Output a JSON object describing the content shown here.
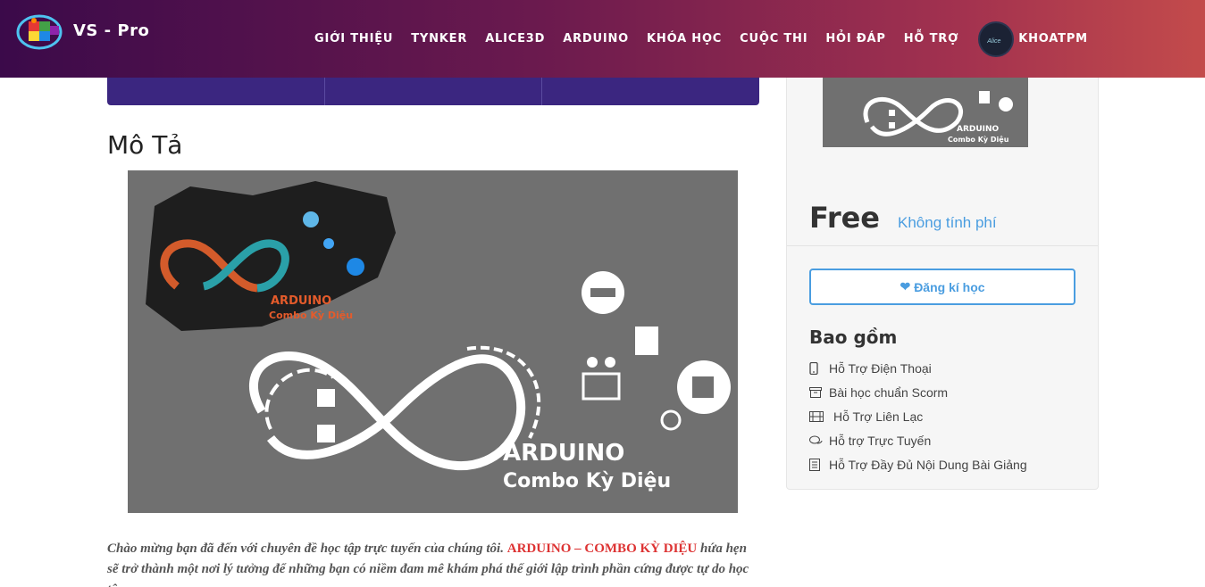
{
  "brand": {
    "name": "VS - Pro"
  },
  "nav": {
    "items": [
      {
        "label": "GIỚI THIỆU"
      },
      {
        "label": "TYNKER"
      },
      {
        "label": "ALICE3D"
      },
      {
        "label": "ARDUINO"
      },
      {
        "label": "KHÓA HỌC"
      },
      {
        "label": "CUỘC THI"
      },
      {
        "label": "HỎI ĐÁP"
      },
      {
        "label": "HỖ TRỢ"
      }
    ],
    "user": {
      "name": "KHOATPM",
      "avatar_text": "Alice"
    }
  },
  "info_strip": {
    "cells": [
      "",
      "",
      ""
    ]
  },
  "description": {
    "title": "Mô Tả",
    "banner": {
      "title": "ARDUINO",
      "subtitle": "Combo Kỳ Diệu"
    },
    "text_before": "Chào mừng bạn đã đến với chuyên đề học tập trực tuyến của chúng tôi. ",
    "highlight": "ARDUINO – COMBO KỲ DIỆU",
    "text_after": " hứa hẹn sẽ trở thành một nơi lý tưởng để những bạn có niềm đam mê khám phá thế giới lập trình phần cứng được tự do học tập,"
  },
  "sidebar": {
    "thumb": {
      "title": "ARDUINO",
      "subtitle": "Combo Kỳ Diệu"
    },
    "price": "Free",
    "price_note": "Không tính phí",
    "enroll_label": "Đăng kí học",
    "includes_title": "Bao gồm",
    "includes": [
      {
        "icon": "phone-icon",
        "label": "Hỗ Trợ Điện Thoại"
      },
      {
        "icon": "archive-icon",
        "label": "Bài học chuẩn Scorm"
      },
      {
        "icon": "film-icon",
        "label": "Hỗ Trợ Liên Lạc"
      },
      {
        "icon": "chat-icon",
        "label": "Hỗ trợ Trực Tuyến"
      },
      {
        "icon": "document-icon",
        "label": "Hỗ Trợ Đầy Đủ Nội Dung Bài Giảng"
      }
    ]
  },
  "colors": {
    "accent": "#4a9de0",
    "highlight": "#d33333",
    "strip": "#3b2680"
  }
}
